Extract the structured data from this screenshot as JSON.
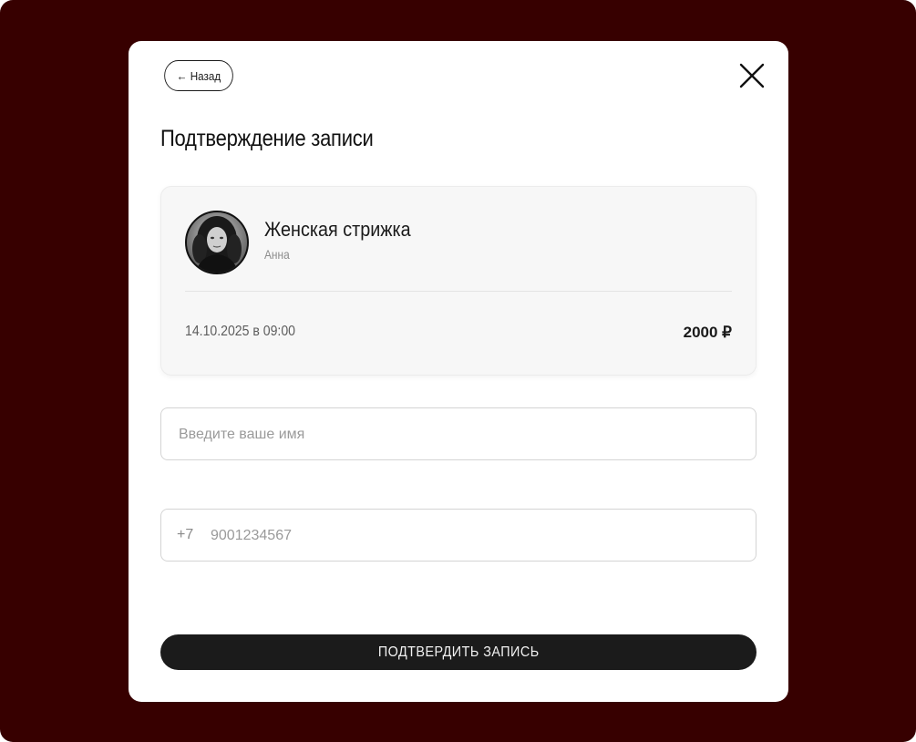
{
  "modal": {
    "back_label": "← Назад",
    "title": "Подтверждение записи",
    "close_icon": "close-icon"
  },
  "booking": {
    "service": "Женская стрижка",
    "master": "Анна",
    "datetime": "14.10.2025 в 09:00",
    "price": "2000 ₽"
  },
  "form": {
    "name_placeholder": "Введите ваше имя",
    "phone_prefix": "+7",
    "phone_placeholder": "9001234567"
  },
  "submit_label": "ПОДТВЕРДИТЬ ЗАПИСЬ",
  "colors": {
    "backdrop": "#370000",
    "modal": "#ffffff",
    "button": "#1b1b1b"
  }
}
